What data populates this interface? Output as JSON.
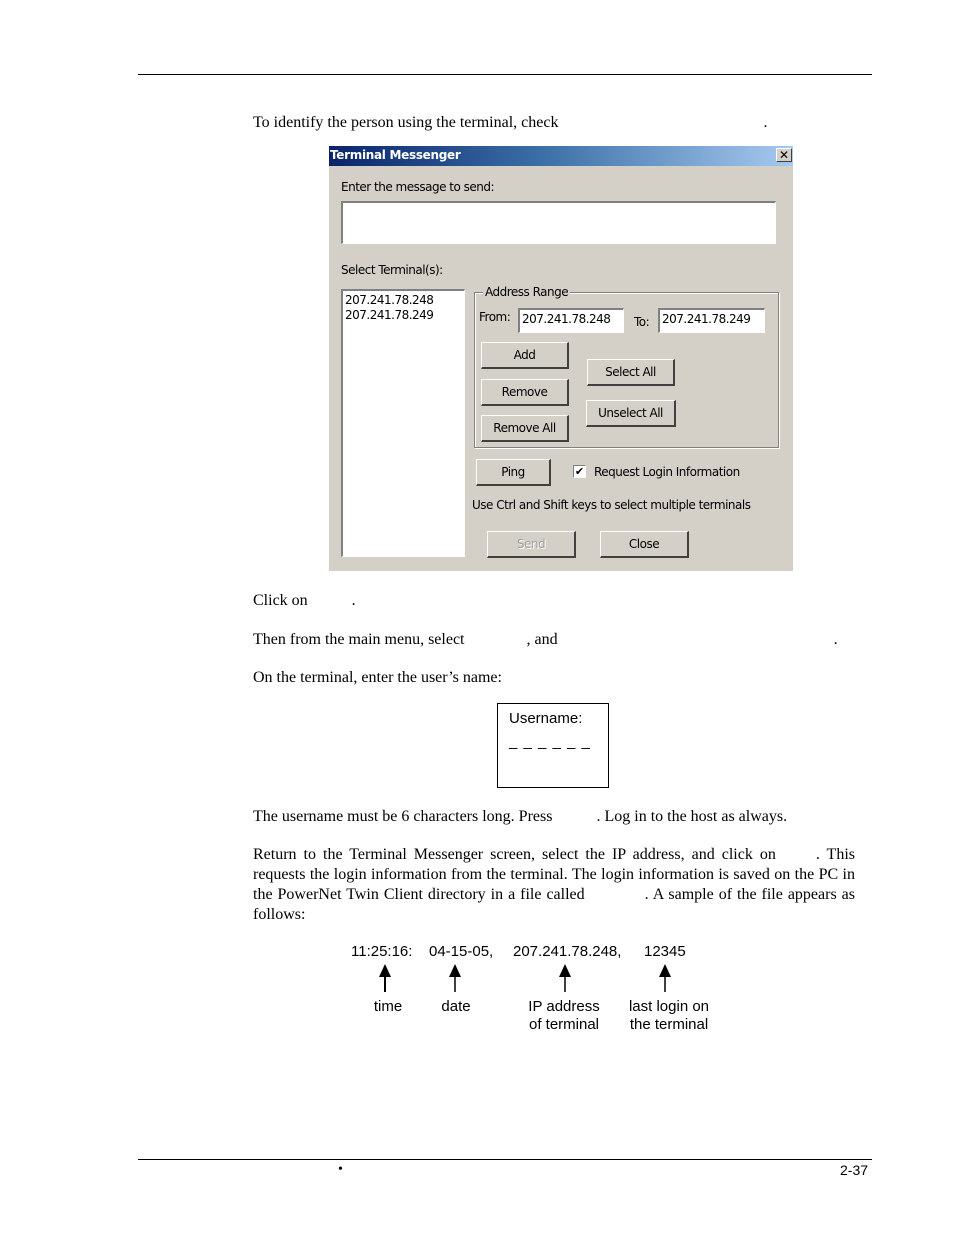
{
  "page": {
    "intro": "To identify the person using the terminal, check",
    "intro_end": ".",
    "step_click": "Click on",
    "step_click_end": ".",
    "step_menu": "Then from the main menu, select",
    "step_menu_mid": ", and",
    "step_menu_end": ".",
    "step_terminal": "On the terminal, enter the user’s name:",
    "username_note_a": "The username must be 6 characters long. Press",
    "username_note_b": ". Log in to the host as always.",
    "return_para_a": "Return to the Terminal Messenger screen, select the IP address, and click on",
    "return_para_b": ". This requests the login information from the terminal. The login information is saved on the PC in the PowerNet Twin Client directory in a file called",
    "return_para_c": ". A sample of the file appears as follows:",
    "footer_bullet": "•",
    "page_number": "2-37"
  },
  "dialog": {
    "title": "Terminal Messenger",
    "close_glyph": "✕",
    "message_label": "Enter the message to send:",
    "message_value": "",
    "select_label": "Select Terminal(s):",
    "terminals": [
      "207.241.78.248",
      "207.241.78.249"
    ],
    "address_range": {
      "legend": "Address Range",
      "from_label": "From:",
      "from_value": "207.241.78.248",
      "to_label": "To:",
      "to_value": "207.241.78.249"
    },
    "buttons": {
      "add": "Add",
      "remove": "Remove",
      "remove_all": "Remove All",
      "select_all": "Select All",
      "unselect_all": "Unselect All",
      "ping": "Ping",
      "send": "Send",
      "close": "Close"
    },
    "request_login": {
      "label": "Request Login Information",
      "checked": true,
      "glyph": "✔"
    },
    "hint": "Use Ctrl and Shift keys to select multiple terminals"
  },
  "terminal_screen": {
    "prompt": "Username:",
    "blanks": "_ _ _ _ _ _"
  },
  "sample_record": {
    "fields": [
      {
        "value": "11:25:16:",
        "label_line1": "time",
        "label_line2": ""
      },
      {
        "value": "04-15-05,",
        "label_line1": "date",
        "label_line2": ""
      },
      {
        "value": "207.241.78.248,",
        "label_line1": "IP address",
        "label_line2": "of terminal"
      },
      {
        "value": "12345",
        "label_line1": "last login on",
        "label_line2": "the terminal"
      }
    ]
  }
}
